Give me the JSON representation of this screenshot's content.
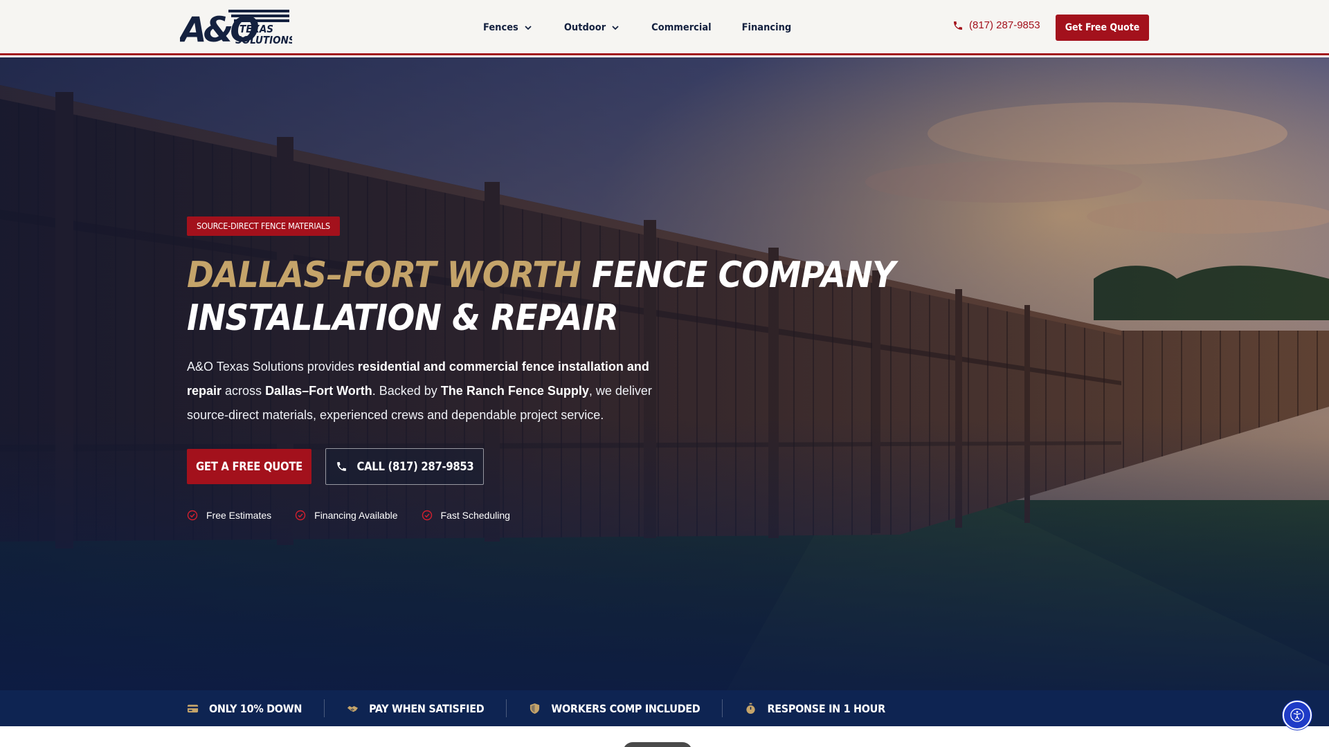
{
  "header": {
    "logo_alt": "A&O Texas Solutions",
    "nav": [
      {
        "label": "Fences",
        "has_dropdown": true
      },
      {
        "label": "Outdoor",
        "has_dropdown": true
      },
      {
        "label": "Commercial",
        "has_dropdown": false
      },
      {
        "label": "Financing",
        "has_dropdown": false
      }
    ],
    "phone": "(817) 287-9853",
    "cta_label": "Get Free Quote"
  },
  "hero": {
    "eyebrow": "SOURCE-DIRECT FENCE MATERIALS",
    "title_gold": "DALLAS–FORT WORTH",
    "title_line1_rest": "FENCE COMPANY",
    "title_line2": "INSTALLATION & REPAIR",
    "desc": {
      "p1": "A&O Texas Solutions provides ",
      "b1": "residential and commercial fence installation and repair",
      "p2": " across ",
      "b2": "Dallas–Fort Worth",
      "p3": ". Backed by ",
      "b3": "The Ranch Fence Supply",
      "p4": ", we deliver source-direct materials, experienced crews and dependable project service."
    },
    "primary_button": "GET A FREE QUOTE",
    "secondary_button": "CALL (817) 287-9853",
    "checks": [
      "Free Estimates",
      "Financing Available",
      "Fast Scheduling"
    ]
  },
  "trust_bar": {
    "items": [
      {
        "label": "ONLY 10% DOWN",
        "icon": "credit-card-icon"
      },
      {
        "label": "PAY WHEN SATISFIED",
        "icon": "handshake-icon"
      },
      {
        "label": "WORKERS COMP INCLUDED",
        "icon": "shield-icon"
      },
      {
        "label": "RESPONSE IN 1 HOUR",
        "icon": "stopwatch-icon"
      }
    ]
  },
  "colors": {
    "brand_red": "#a3111c",
    "navy": "#0e2452",
    "gold": "#c5a46a",
    "header_bg": "#f6f5f2",
    "accessibility_blue": "#1f3bc7"
  }
}
